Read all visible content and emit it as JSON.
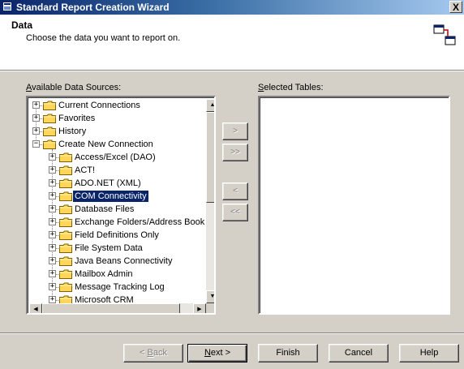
{
  "window": {
    "title": "Standard Report Creation Wizard",
    "close_glyph": "X"
  },
  "header": {
    "title": "Data",
    "description": "Choose the data you want to report on.",
    "icon": "table-link-icon"
  },
  "available": {
    "label_prefix": "",
    "label_mnemonic": "A",
    "label_rest": "vailable Data Sources:",
    "items": [
      {
        "label": "Current Connections",
        "level": 0,
        "state": "collapsed"
      },
      {
        "label": "Favorites",
        "level": 0,
        "state": "collapsed"
      },
      {
        "label": "History",
        "level": 0,
        "state": "collapsed"
      },
      {
        "label": "Create New Connection",
        "level": 0,
        "state": "expanded"
      },
      {
        "label": "Access/Excel (DAO)",
        "level": 1,
        "state": "collapsed"
      },
      {
        "label": "ACT!",
        "level": 1,
        "state": "collapsed"
      },
      {
        "label": "ADO.NET (XML)",
        "level": 1,
        "state": "collapsed"
      },
      {
        "label": "COM Connectivity",
        "level": 1,
        "state": "collapsed",
        "selected": true
      },
      {
        "label": "Database Files",
        "level": 1,
        "state": "collapsed"
      },
      {
        "label": "Exchange Folders/Address Book",
        "level": 1,
        "state": "collapsed"
      },
      {
        "label": "Field Definitions Only",
        "level": 1,
        "state": "collapsed"
      },
      {
        "label": "File System Data",
        "level": 1,
        "state": "collapsed"
      },
      {
        "label": "Java Beans Connectivity",
        "level": 1,
        "state": "collapsed"
      },
      {
        "label": "Mailbox Admin",
        "level": 1,
        "state": "collapsed"
      },
      {
        "label": "Message Tracking Log",
        "level": 1,
        "state": "collapsed"
      },
      {
        "label": "Microsoft CRM",
        "level": 1,
        "state": "collapsed"
      }
    ]
  },
  "selected": {
    "label_mnemonic": "S",
    "label_rest": "elected Tables:"
  },
  "transfer": {
    "add_one": ">",
    "add_all": ">>",
    "remove_one": "<",
    "remove_all": "<<"
  },
  "footer": {
    "back_prefix": "< ",
    "back_mnemonic": "B",
    "back_rest": "ack",
    "next_mnemonic": "N",
    "next_rest": "ext >",
    "finish": "Finish",
    "cancel": "Cancel",
    "help": "Help"
  },
  "colors": {
    "title_start": "#0a246a",
    "selection": "#0a246a",
    "folder": "#ffd65a"
  }
}
